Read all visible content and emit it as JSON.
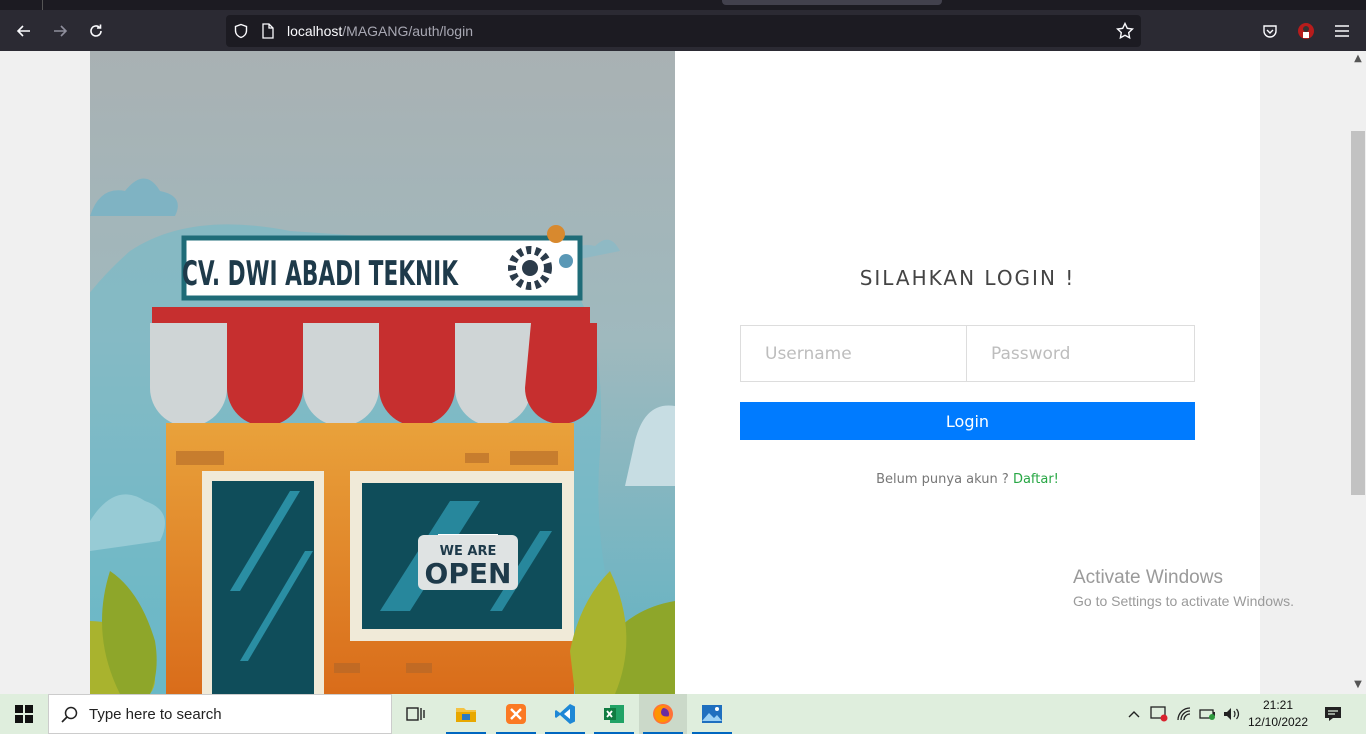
{
  "browser": {
    "url_host": "localhost",
    "url_path": "/MAGANG/auth/login"
  },
  "illustration": {
    "sign_text": "CV. DWI ABADI TEKNIK",
    "door_sign_line1": "WE ARE",
    "door_sign_line2": "OPEN"
  },
  "login": {
    "title": "SILAHKAN LOGIN !",
    "username_placeholder": "Username",
    "password_placeholder": "Password",
    "button_label": "Login",
    "register_prompt": "Belum punya akun ?",
    "register_link": "Daftar!"
  },
  "watermark": {
    "line1": "Activate Windows",
    "line2": "Go to Settings to activate Windows."
  },
  "taskbar": {
    "search_placeholder": "Type here to search",
    "time": "21:21",
    "date": "12/10/2022"
  },
  "colors": {
    "primary_button": "#007bff",
    "link_green": "#28a745"
  }
}
